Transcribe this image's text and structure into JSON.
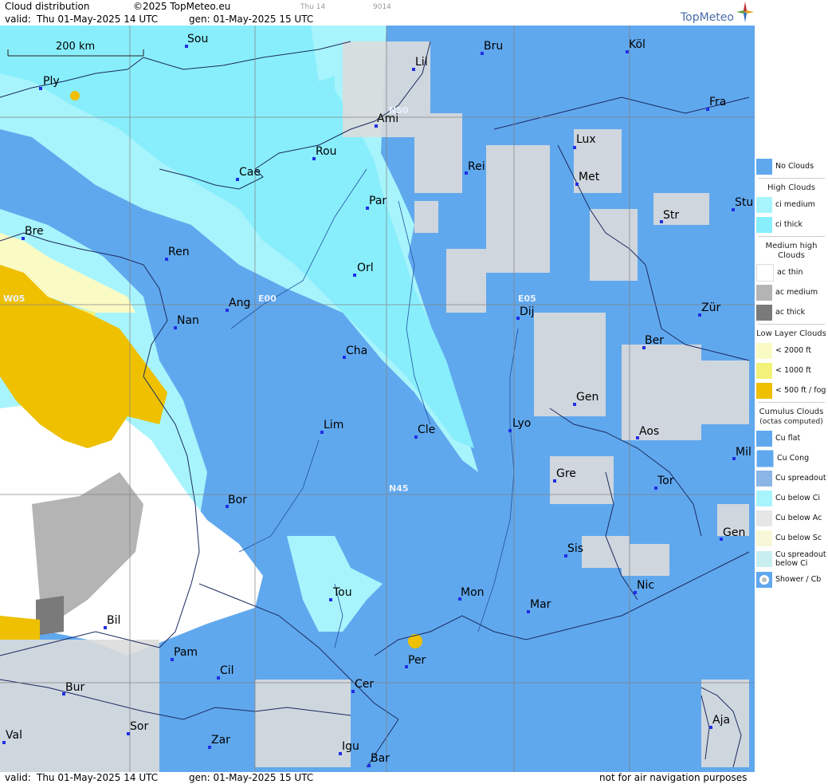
{
  "header": {
    "title": "Cloud distribution",
    "copyright": "©2025 TopMeteo.eu",
    "valid_label": "valid:",
    "valid_value": "Thu  01-May-2025  14 UTC",
    "gen_value": "gen: 01-May-2025 15 UTC",
    "faint_day": "Thu 14",
    "faint_code": "9014",
    "brand": "TopMeteo"
  },
  "scale": {
    "label": "200 km"
  },
  "grid_labels": [
    "N50",
    "N45",
    "W05",
    "E00",
    "E05"
  ],
  "cities": [
    {
      "name": "Sou"
    },
    {
      "name": "Ply"
    },
    {
      "name": "Lil"
    },
    {
      "name": "Bru"
    },
    {
      "name": "Köl"
    },
    {
      "name": "Ami"
    },
    {
      "name": "Fra"
    },
    {
      "name": "Rou"
    },
    {
      "name": "Lux"
    },
    {
      "name": "Cae"
    },
    {
      "name": "Rei"
    },
    {
      "name": "Met"
    },
    {
      "name": "Par"
    },
    {
      "name": "Stu"
    },
    {
      "name": "Str"
    },
    {
      "name": "Bre"
    },
    {
      "name": "Ren"
    },
    {
      "name": "Orl"
    },
    {
      "name": "Ang"
    },
    {
      "name": "Dij"
    },
    {
      "name": "Zür"
    },
    {
      "name": "Nan"
    },
    {
      "name": "Ber"
    },
    {
      "name": "Cha"
    },
    {
      "name": "Gen"
    },
    {
      "name": "Lim"
    },
    {
      "name": "Cle"
    },
    {
      "name": "Lyo"
    },
    {
      "name": "Aos"
    },
    {
      "name": "Mil"
    },
    {
      "name": "Gre"
    },
    {
      "name": "Tor"
    },
    {
      "name": "Bor"
    },
    {
      "name": "Gen"
    },
    {
      "name": "Sis"
    },
    {
      "name": "Nic"
    },
    {
      "name": "Tou"
    },
    {
      "name": "Mon"
    },
    {
      "name": "Mar"
    },
    {
      "name": "Bil"
    },
    {
      "name": "Per"
    },
    {
      "name": "Pam"
    },
    {
      "name": "Cil"
    },
    {
      "name": "Bur"
    },
    {
      "name": "Cer"
    },
    {
      "name": "Sor"
    },
    {
      "name": "Aja"
    },
    {
      "name": "Val"
    },
    {
      "name": "Zar"
    },
    {
      "name": "Igu"
    },
    {
      "name": "Bar"
    }
  ],
  "legend": {
    "no_clouds": "No Clouds",
    "high_title": "High Clouds",
    "ci_medium": "ci medium",
    "ci_thick": "ci thick",
    "medium_title": "Medium high Clouds",
    "ac_thin": "ac thin",
    "ac_medium": "ac medium",
    "ac_thick": "ac thick",
    "low_title": "Low Layer Clouds",
    "low_2000": "< 2000 ft",
    "low_1000": "< 1000 ft",
    "low_500": "< 500 ft / fog",
    "cu_title": "Cumulus Clouds",
    "cu_sub": "(octas computed)",
    "cu_flat": "Cu flat",
    "cu_cong": "Cu Cong",
    "cu_spread": "Cu spreadout",
    "cu_below_ci": "Cu below Ci",
    "cu_below_ac": "Cu below Ac",
    "cu_below_sc": "Cu below Sc",
    "cu_spread_ci": "Cu spreadout below Ci",
    "shower": "Shower / Cb"
  },
  "footer": {
    "valid_label": "valid:",
    "valid_value": "Thu  01-May-2025  14 UTC",
    "gen_value": "gen: 01-May-2025 15 UTC",
    "note": "not for air navigation purposes"
  },
  "colors": {
    "no_clouds": "#60a8ee",
    "ci_medium": "#a8f4fc",
    "ci_thick": "#88eefc",
    "ac_thin": "#ffffff",
    "ac_medium": "#b4b4b4",
    "ac_thick": "#7a7a7a",
    "low_2000": "#fafac4",
    "low_1000": "#f2f27a",
    "low_500": "#eec000",
    "city_dot": "#1f2ee6"
  }
}
